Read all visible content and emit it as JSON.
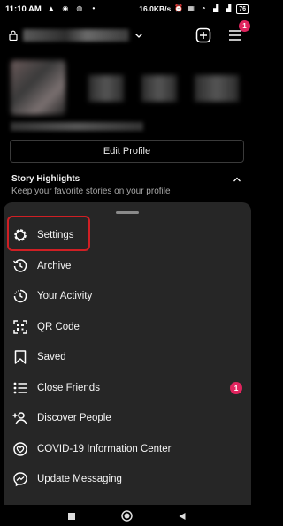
{
  "status_bar": {
    "time": "11:10 AM",
    "speed": "16.0KB/s",
    "battery": "76"
  },
  "top_bar": {
    "notification_count": "1"
  },
  "edit_profile_label": "Edit Profile",
  "story_highlights": {
    "title": "Story Highlights",
    "subtitle": "Keep your favorite stories on your profile"
  },
  "menu": {
    "items": [
      {
        "label": "Settings",
        "icon": "gear-icon"
      },
      {
        "label": "Archive",
        "icon": "archive-icon"
      },
      {
        "label": "Your Activity",
        "icon": "activity-icon"
      },
      {
        "label": "QR Code",
        "icon": "qr-code-icon"
      },
      {
        "label": "Saved",
        "icon": "bookmark-icon"
      },
      {
        "label": "Close Friends",
        "icon": "list-icon",
        "badge": "1"
      },
      {
        "label": "Discover People",
        "icon": "add-person-icon"
      },
      {
        "label": "COVID-19 Information Center",
        "icon": "covid-info-icon"
      },
      {
        "label": "Update Messaging",
        "icon": "messenger-icon"
      }
    ]
  },
  "colors": {
    "background": "#000000",
    "sheet": "#262626",
    "badge": "#e0245e",
    "highlight_box": "#d01f24"
  }
}
